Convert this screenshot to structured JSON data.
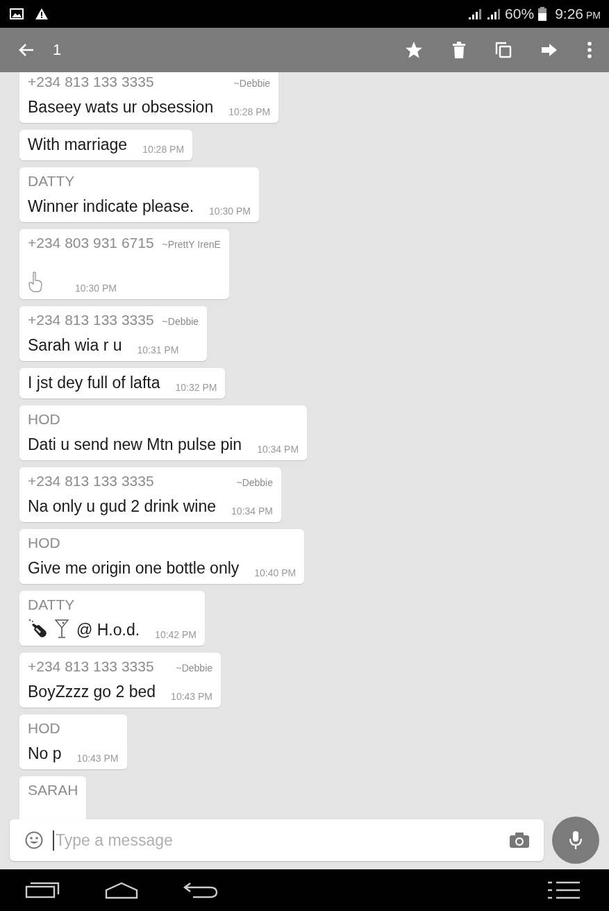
{
  "status_bar": {
    "battery": "60%",
    "time": "9:26",
    "period": "PM"
  },
  "toolbar": {
    "selected_count": "1"
  },
  "messages": [
    {
      "kind": "text",
      "sender": "+234 813 133 3335",
      "alias": "~Debbie",
      "text": "Baseey wats ur obsession",
      "time": "10:28 PM"
    },
    {
      "kind": "text",
      "text": "With marriage",
      "time": "10:28 PM"
    },
    {
      "kind": "text",
      "sender": "DATTY",
      "text": "Winner indicate please.",
      "time": "10:30 PM"
    },
    {
      "kind": "pointer",
      "sender": "+234 803 931 6715",
      "alias": "~PrettY IrenE",
      "time": "10:30 PM"
    },
    {
      "kind": "text",
      "sender": "+234 813 133 3335",
      "alias": "~Debbie",
      "text": "Sarah wia r u",
      "time": "10:31 PM"
    },
    {
      "kind": "text",
      "text": "I jst dey full of lafta",
      "time": "10:32 PM"
    },
    {
      "kind": "text",
      "sender": "HOD",
      "text": "Dati u send new Mtn pulse pin",
      "time": "10:34 PM"
    },
    {
      "kind": "text",
      "sender": "+234 813 133 3335",
      "alias": "~Debbie",
      "text": "Na only u gud 2 drink wine",
      "time": "10:34 PM"
    },
    {
      "kind": "text",
      "sender": "HOD",
      "text": "Give me origin one bottle only",
      "time": "10:40 PM"
    },
    {
      "kind": "drinks",
      "sender": "DATTY",
      "text": "@ H.o.d.",
      "time": "10:42 PM"
    },
    {
      "kind": "text",
      "sender": "+234 813 133 3335",
      "alias": "~Debbie",
      "text": "BoyZzzz go 2 bed",
      "time": "10:43 PM"
    },
    {
      "kind": "text",
      "sender": "HOD",
      "text": "No p",
      "time": "10:43 PM"
    },
    {
      "kind": "cut",
      "sender": "SARAH"
    }
  ],
  "composer": {
    "placeholder": "Type a message"
  }
}
